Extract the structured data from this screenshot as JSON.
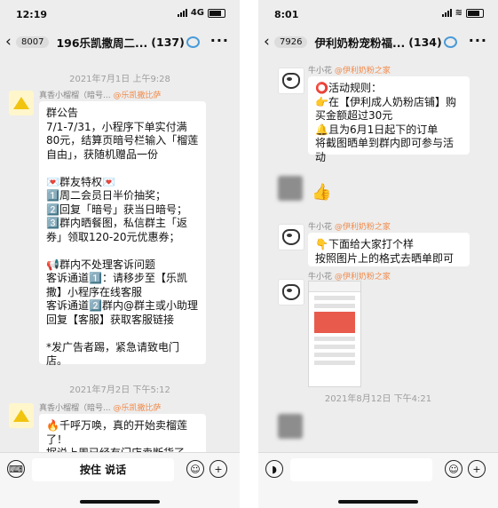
{
  "left": {
    "status": {
      "time": "12:19",
      "network": "4G"
    },
    "nav": {
      "badge": "8007",
      "title": "196乐凯撒周二...",
      "count": "(137)"
    },
    "timestamps": [
      "2021年7月1日 上午9:28",
      "2021年7月2日 下午5:12"
    ],
    "messages": [
      {
        "sender": "真香小榴榴（暗号...",
        "tag": "@乐凯撒比萨",
        "text": "群公告\n7/1-7/31，小程序下单实付满80元，结算页暗号栏输入「榴莲自由」，获随机赠品一份\n\n💌群友特权💌\n1️⃣周二会员日半价抽奖；\n2️⃣回复「暗号」获当日暗号；\n3️⃣群内晒餐图，私信群主「返券」领取120-20元优惠券；\n\n📢群内不处理客诉问题\n客诉通道1️⃣：请移步至【乐凯撒】小程序在线客服\n客诉通道2️⃣群内@群主或小助理回复【客服】获取客服链接\n\n*发广告者踢，紧急请致电门店。"
      },
      {
        "sender": "真香小榴榴（暗号...",
        "tag": "@乐凯撒比萨",
        "text": "🔥千呼万唤，真的开始卖榴莲了！\n据说上周已经有门店卖断货了，"
      }
    ],
    "bottom": {
      "hold_talk": "按住 说话"
    }
  },
  "right": {
    "status": {
      "time": "8:01"
    },
    "nav": {
      "badge": "7926",
      "title": "伊利奶粉宠粉福...",
      "count": "(134)"
    },
    "timestamps": [
      "2021年8月12日 下午4:21"
    ],
    "messages": [
      {
        "sender": "牛小花",
        "tag": "@伊利奶粉之家",
        "text": "⭕活动规则：\n👉在【伊利成人奶粉店铺】购买金额超过30元\n🔔且为6月1日起下的订单\n将截图晒单到群内即可参与活动"
      },
      {
        "sender": "",
        "tag": "",
        "text": "👍"
      },
      {
        "sender": "牛小花",
        "tag": "@伊利奶粉之家",
        "text": "👇下面给大家打个样\n按照图片上的格式去晒单即可"
      },
      {
        "sender": "牛小花",
        "tag": "@伊利奶粉之家",
        "text": ""
      }
    ]
  }
}
